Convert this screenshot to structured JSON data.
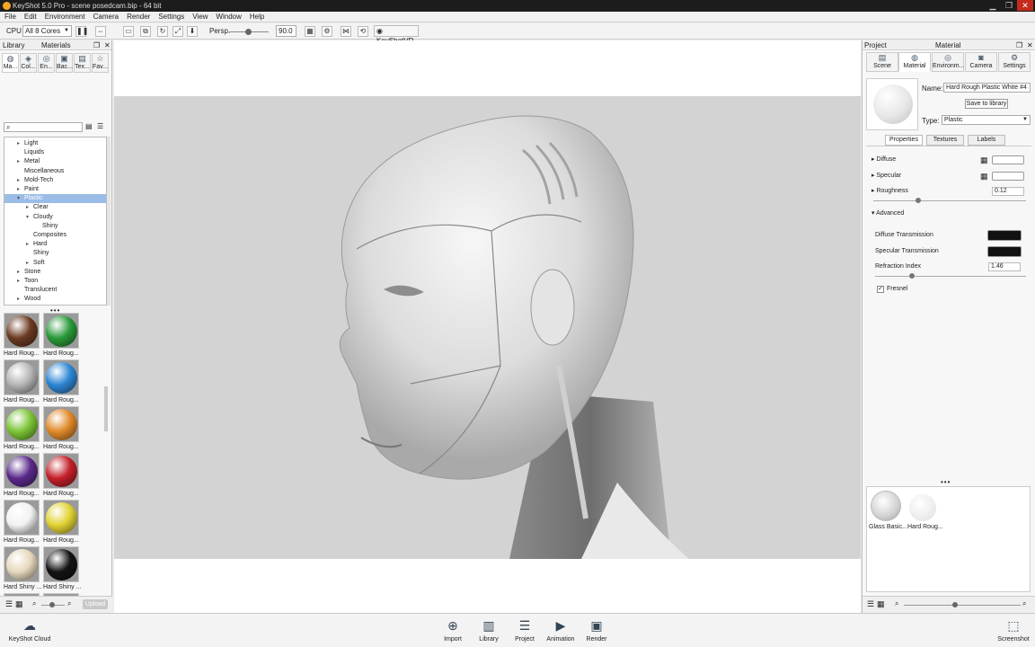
{
  "window": {
    "title": "KeyShot 5.0 Pro - scene posedcam.bip - 64 bit"
  },
  "menu": [
    "File",
    "Edit",
    "Environment",
    "Camera",
    "Render",
    "Settings",
    "View",
    "Window",
    "Help"
  ],
  "toolbar": {
    "cpu_label": "CPU",
    "cores": "All 8 Cores",
    "persp_label": "Persp.",
    "persp_value": "90.0",
    "keyshotvr": "KeyShotVR"
  },
  "library": {
    "panel_title": "Library",
    "section_title": "Materials",
    "tabs": [
      "Ma...",
      "Col...",
      "En...",
      "Bac...",
      "Tex...",
      "Fav..."
    ],
    "tree": [
      {
        "label": "Light",
        "depth": 1,
        "arrow": "▸"
      },
      {
        "label": "Liquids",
        "depth": 1,
        "arrow": ""
      },
      {
        "label": "Metal",
        "depth": 1,
        "arrow": "▸"
      },
      {
        "label": "Miscellaneous",
        "depth": 1,
        "arrow": ""
      },
      {
        "label": "Mold-Tech",
        "depth": 1,
        "arrow": "▸"
      },
      {
        "label": "Paint",
        "depth": 1,
        "arrow": "▸"
      },
      {
        "label": "Plastic",
        "depth": 1,
        "arrow": "▾",
        "selected": true
      },
      {
        "label": "Clear",
        "depth": 2,
        "arrow": "▸"
      },
      {
        "label": "Cloudy",
        "depth": 2,
        "arrow": "▾"
      },
      {
        "label": "Shiny",
        "depth": 3,
        "arrow": ""
      },
      {
        "label": "Composites",
        "depth": 2,
        "arrow": ""
      },
      {
        "label": "Hard",
        "depth": 2,
        "arrow": "▸"
      },
      {
        "label": "Shiny",
        "depth": 2,
        "arrow": ""
      },
      {
        "label": "Soft",
        "depth": 2,
        "arrow": "▸"
      },
      {
        "label": "Stone",
        "depth": 1,
        "arrow": "▸"
      },
      {
        "label": "Toon",
        "depth": 1,
        "arrow": "▸"
      },
      {
        "label": "Translucent",
        "depth": 1,
        "arrow": ""
      },
      {
        "label": "Wood",
        "depth": 1,
        "arrow": "▸"
      }
    ],
    "swatches": [
      {
        "label": "Hard Roug...",
        "color": "#6b3a22"
      },
      {
        "label": "Hard Roug...",
        "color": "#2a9a3a"
      },
      {
        "label": "Hard Roug...",
        "color": "#b5b5b5"
      },
      {
        "label": "Hard Roug...",
        "color": "#2e86d4"
      },
      {
        "label": "Hard Roug...",
        "color": "#7cc436"
      },
      {
        "label": "Hard Roug...",
        "color": "#e08a2a"
      },
      {
        "label": "Hard Roug...",
        "color": "#5a2a8a"
      },
      {
        "label": "Hard Roug...",
        "color": "#c4202a"
      },
      {
        "label": "Hard Roug...",
        "color": "#f2f2f2"
      },
      {
        "label": "Hard Roug...",
        "color": "#e2d232"
      },
      {
        "label": "Hard Shiny ...",
        "color": "#e6d8bc"
      },
      {
        "label": "Hard Shiny ...",
        "color": "#141414"
      },
      {
        "label": "",
        "color": "#1f5fb8"
      },
      {
        "label": "",
        "color": "#7a3a1e"
      }
    ],
    "upload": "Upload"
  },
  "project": {
    "panel_title": "Project",
    "section_title": "Material",
    "tabs": [
      "Scene",
      "Material",
      "Environm...",
      "Camera",
      "Settings"
    ],
    "name_label": "Name:",
    "name_value": "Hard Rough Plastic White #4",
    "save_button": "Save to library",
    "type_label": "Type:",
    "type_value": "Plastic",
    "subtabs": [
      "Properties",
      "Textures",
      "Labels"
    ],
    "diffuse": "Diffuse",
    "specular": "Specular",
    "roughness": "Roughness",
    "roughness_value": "0.12",
    "advanced": "Advanced",
    "diffuse_transmission": "Diffuse Transmission",
    "specular_transmission": "Specular Transmission",
    "refraction_index": "Refraction Index",
    "refraction_value": "1.46",
    "fresnel": "Fresnel",
    "thumbs": [
      "Glass Basic...",
      "Hard Roug..."
    ]
  },
  "dock": {
    "cloud": "KeyShot Cloud",
    "items": [
      "Import",
      "Library",
      "Project",
      "Animation",
      "Render"
    ],
    "screenshot": "Screenshot"
  },
  "colors": {
    "accent": "#9bbce6",
    "dark_swatch": "#111111"
  }
}
